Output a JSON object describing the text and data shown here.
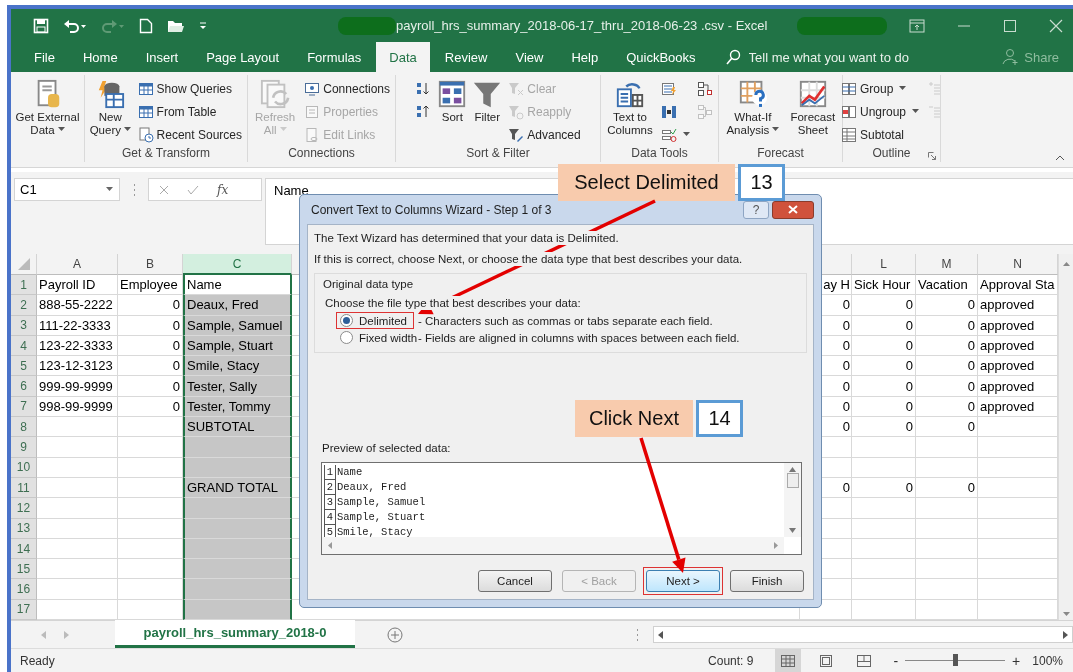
{
  "title_bar": {
    "title": "payroll_hrs_summary_2018-06-17_thru_2018-06-23 .csv  -  Excel"
  },
  "tabs": [
    {
      "label": "File",
      "selected": false
    },
    {
      "label": "Home",
      "selected": false
    },
    {
      "label": "Insert",
      "selected": false
    },
    {
      "label": "Page Layout",
      "selected": false
    },
    {
      "label": "Formulas",
      "selected": false
    },
    {
      "label": "Data",
      "selected": true
    },
    {
      "label": "Review",
      "selected": false
    },
    {
      "label": "View",
      "selected": false
    },
    {
      "label": "Help",
      "selected": false
    },
    {
      "label": "QuickBooks",
      "selected": false
    }
  ],
  "tell_me": {
    "placeholder": "Tell me what you want to do"
  },
  "share": {
    "label": "Share"
  },
  "ribbon": {
    "groups": [
      {
        "items": [
          {
            "kind": "large",
            "label": "Get External Data",
            "dropdown": true,
            "disabled": false
          }
        ]
      },
      {
        "label": "Get & Transform",
        "items": [
          {
            "kind": "large",
            "label": "New Query",
            "dropdown": true,
            "disabled": false
          },
          {
            "kind": "small",
            "label": "Show Queries",
            "dropdown": false,
            "disabled": false
          },
          {
            "kind": "small",
            "label": "From Table",
            "dropdown": false,
            "disabled": false
          },
          {
            "kind": "small",
            "label": "Recent Sources",
            "dropdown": false,
            "disabled": false
          }
        ]
      },
      {
        "label": "Connections",
        "items": [
          {
            "kind": "large",
            "label": "Refresh All",
            "dropdown": true,
            "disabled": true
          },
          {
            "kind": "small",
            "label": "Connections",
            "dropdown": false,
            "disabled": false
          },
          {
            "kind": "small",
            "label": "Properties",
            "dropdown": false,
            "disabled": true
          },
          {
            "kind": "small",
            "label": "Edit Links",
            "dropdown": false,
            "disabled": true
          }
        ]
      },
      {
        "label": "Sort & Filter",
        "items": [
          {
            "kind": "icon",
            "dropdown": false,
            "disabled": false
          },
          {
            "kind": "icon",
            "dropdown": false,
            "disabled": false
          },
          {
            "kind": "large",
            "label": "Sort",
            "dropdown": false,
            "disabled": false
          },
          {
            "kind": "large",
            "label": "Filter",
            "dropdown": false,
            "disabled": false
          },
          {
            "kind": "small",
            "label": "Clear",
            "dropdown": false,
            "disabled": true
          },
          {
            "kind": "small",
            "label": "Reapply",
            "dropdown": false,
            "disabled": true
          },
          {
            "kind": "small",
            "label": "Advanced",
            "dropdown": false,
            "disabled": false
          }
        ]
      },
      {
        "label": "Data Tools",
        "items": [
          {
            "kind": "large",
            "label": "Text to Columns",
            "dropdown": false,
            "disabled": false
          },
          {
            "kind": "icon",
            "dropdown": false,
            "disabled": false
          },
          {
            "kind": "icon",
            "dropdown": false,
            "disabled": false
          },
          {
            "kind": "icon",
            "dropdown": true,
            "disabled": false
          },
          {
            "kind": "icon",
            "dropdown": false,
            "disabled": false
          },
          {
            "kind": "icon",
            "dropdown": false,
            "disabled": true
          }
        ]
      },
      {
        "label": "Forecast",
        "items": [
          {
            "kind": "large",
            "label": "What-If Analysis",
            "dropdown": true,
            "disabled": false
          },
          {
            "kind": "large",
            "label": "Forecast Sheet",
            "dropdown": false,
            "disabled": false
          }
        ]
      },
      {
        "label": "Outline",
        "launcher": true,
        "items": [
          {
            "kind": "small",
            "label": "Group",
            "dropdown": true,
            "disabled": false
          },
          {
            "kind": "small",
            "label": "Ungroup",
            "dropdown": true,
            "disabled": false
          },
          {
            "kind": "small",
            "label": "Subtotal",
            "dropdown": false,
            "disabled": false
          },
          {
            "kind": "icon",
            "dropdown": false,
            "disabled": true
          },
          {
            "kind": "icon",
            "dropdown": false,
            "disabled": true
          }
        ]
      }
    ]
  },
  "formula_bar": {
    "name_box": "C1",
    "insert_function": "fx",
    "formula": "Name"
  },
  "sheet": {
    "columns": [
      {
        "label": "A",
        "selected": false
      },
      {
        "label": "B",
        "selected": false
      },
      {
        "label": "C",
        "selected": true
      },
      {
        "label": "L",
        "selected": false
      },
      {
        "label": "M",
        "selected": false
      },
      {
        "label": "N",
        "selected": false
      }
    ],
    "rows": [
      {
        "number": "1",
        "a": "Payroll ID",
        "b": "Employee",
        "c": "Name",
        "k": "ay H",
        "l": "Sick Hour",
        "m": "Vacation",
        "n": "Approval Sta"
      },
      {
        "number": "2",
        "a": "888-55-2222",
        "b": "0",
        "c": "Deaux, Fred",
        "k": "0",
        "l": "0",
        "m": "0",
        "n": "approved"
      },
      {
        "number": "3",
        "a": "111-22-3333",
        "b": "0",
        "c": "Sample, Samuel",
        "k": "0",
        "l": "0",
        "m": "0",
        "n": "approved"
      },
      {
        "number": "4",
        "a": "123-22-3333",
        "b": "0",
        "c": "Sample, Stuart",
        "k": "0",
        "l": "0",
        "m": "0",
        "n": "approved"
      },
      {
        "number": "5",
        "a": "123-12-3123",
        "b": "0",
        "c": "Smile, Stacy",
        "k": "0",
        "l": "0",
        "m": "0",
        "n": "approved"
      },
      {
        "number": "6",
        "a": "999-99-9999",
        "b": "0",
        "c": "Tester, Sally",
        "k": "0",
        "l": "0",
        "m": "0",
        "n": "approved"
      },
      {
        "number": "7",
        "a": "998-99-9999",
        "b": "0",
        "c": "Tester, Tommy",
        "k": "0",
        "l": "0",
        "m": "0",
        "n": "approved"
      },
      {
        "number": "8",
        "c": "SUBTOTAL",
        "k": "0",
        "l": "0",
        "m": "0"
      },
      {
        "number": "9"
      },
      {
        "number": "10"
      },
      {
        "number": "11",
        "c": "GRAND TOTAL",
        "k": "0",
        "l": "0",
        "m": "0"
      },
      {
        "number": "12"
      },
      {
        "number": "13"
      },
      {
        "number": "14"
      },
      {
        "number": "15"
      },
      {
        "number": "16"
      },
      {
        "number": "17"
      }
    ]
  },
  "sheet_tabs": [
    {
      "label": "payroll_hrs_summary_2018-0",
      "selected": true
    }
  ],
  "status_bar": {
    "mode": "Ready",
    "count": "Count: 9",
    "views": [
      {
        "selected": true
      },
      {
        "selected": false
      },
      {
        "selected": false
      }
    ],
    "zoom_out": "-",
    "zoom_in": "+",
    "zoom": {
      "level": 0.5,
      "reading": "100%"
    }
  },
  "dialog": {
    "title": "Convert Text to Columns Wizard - Step 1 of 3",
    "help": "?",
    "intro": [
      "The Text Wizard has determined that your data is Delimited.",
      "If this is correct, choose Next, or choose the data type that best describes your data."
    ],
    "group_label": "Original data type",
    "prompt": "Choose the file type that best describes your data:",
    "options": [
      {
        "label": "Delimited",
        "description": "- Characters such as commas or tabs separate each field.",
        "selected": true,
        "highlighted": true
      },
      {
        "label": "Fixed width",
        "description": "- Fields are aligned in columns with spaces between each field.",
        "selected": false,
        "highlighted": false
      }
    ],
    "preview_label": "Preview of selected data:",
    "preview": [
      {
        "number": "1",
        "text": "Name"
      },
      {
        "number": "2",
        "text": "Deaux, Fred"
      },
      {
        "number": "3",
        "text": "Sample, Samuel"
      },
      {
        "number": "4",
        "text": "Sample, Stuart"
      },
      {
        "number": "5",
        "text": "Smile, Stacy"
      }
    ],
    "buttons": [
      {
        "label": "Cancel",
        "disabled": false,
        "default": false,
        "highlighted": false
      },
      {
        "label": "< Back",
        "disabled": true,
        "default": false,
        "highlighted": false
      },
      {
        "label": "Next >",
        "disabled": false,
        "default": true,
        "highlighted": true
      },
      {
        "label": "Finish",
        "disabled": false,
        "default": false,
        "highlighted": false
      }
    ]
  },
  "callouts": [
    {
      "label": "Select Delimited",
      "step": "13"
    },
    {
      "label": "Click Next",
      "step": "14"
    }
  ]
}
